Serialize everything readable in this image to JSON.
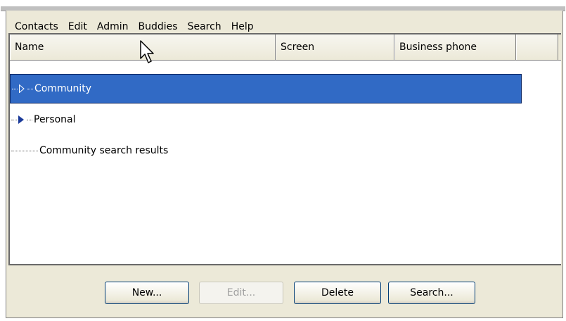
{
  "menubar": {
    "items": [
      "Contacts",
      "Edit",
      "Admin",
      "Buddies",
      "Search",
      "Help"
    ]
  },
  "list": {
    "columns": [
      "Name",
      "Screen",
      "Business phone",
      ""
    ],
    "rows": [
      {
        "label": "Community",
        "expandable": true,
        "selected": true
      },
      {
        "label": "Personal",
        "expandable": true,
        "selected": false
      },
      {
        "label": "Community search results",
        "expandable": false,
        "selected": false
      }
    ]
  },
  "buttons": {
    "new_label": "New...",
    "edit_label": "Edit...",
    "delete_label": "Delete",
    "search_label": "Search..."
  },
  "colors": {
    "selection": "#316ac5",
    "window_bg": "#ece9d8"
  },
  "icons": [
    "expand-arrow-icon",
    "mouse-pointer-icon"
  ]
}
